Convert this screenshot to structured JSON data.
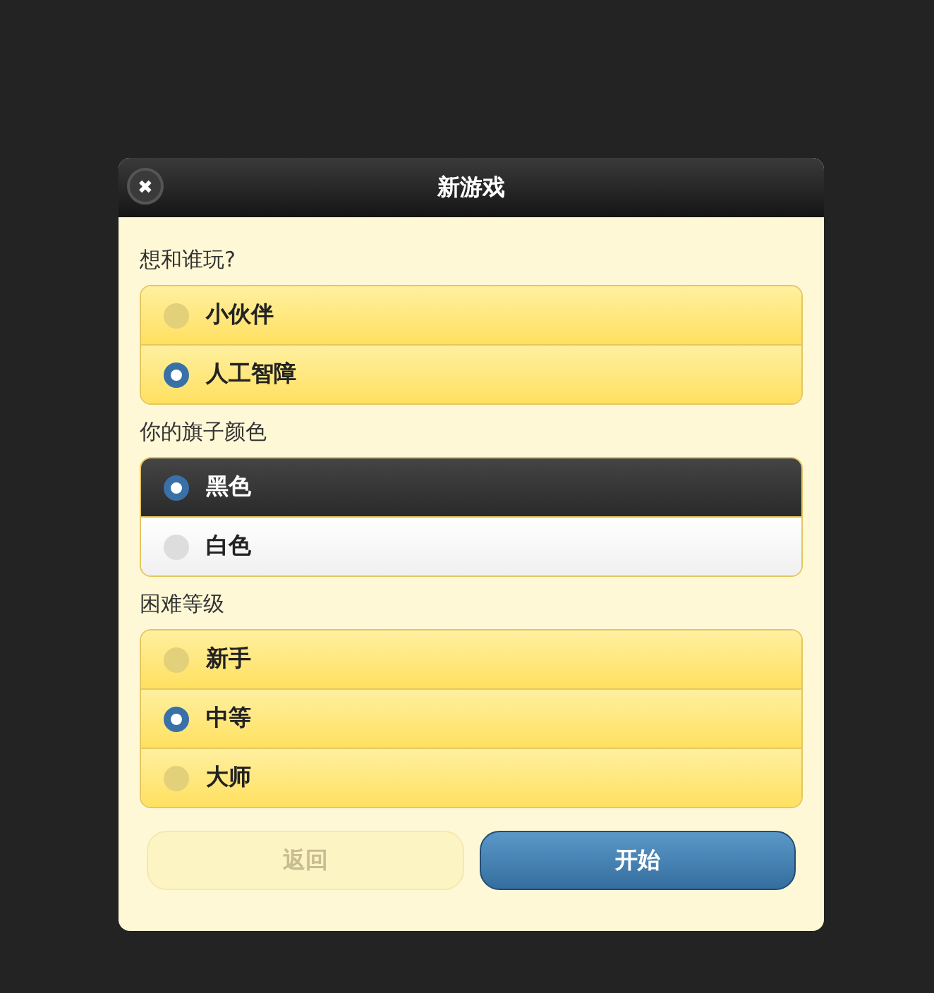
{
  "dialog": {
    "title": "新游戏",
    "close_icon": "✖"
  },
  "groups": [
    {
      "label": "想和谁玩?",
      "options": [
        {
          "label": "小伙伴",
          "selected": false,
          "kind": "yellow"
        },
        {
          "label": "人工智障",
          "selected": true,
          "kind": "yellow"
        }
      ]
    },
    {
      "label": "你的旗子颜色",
      "options": [
        {
          "label": "黑色",
          "selected": true,
          "kind": "dark"
        },
        {
          "label": "白色",
          "selected": false,
          "kind": "white"
        }
      ]
    },
    {
      "label": "困难等级",
      "options": [
        {
          "label": "新手",
          "selected": false,
          "kind": "yellow"
        },
        {
          "label": "中等",
          "selected": true,
          "kind": "yellow"
        },
        {
          "label": "大师",
          "selected": false,
          "kind": "yellow"
        }
      ]
    }
  ],
  "buttons": [
    {
      "label": "返回",
      "disabled": true
    },
    {
      "label": "开始",
      "disabled": false
    }
  ]
}
